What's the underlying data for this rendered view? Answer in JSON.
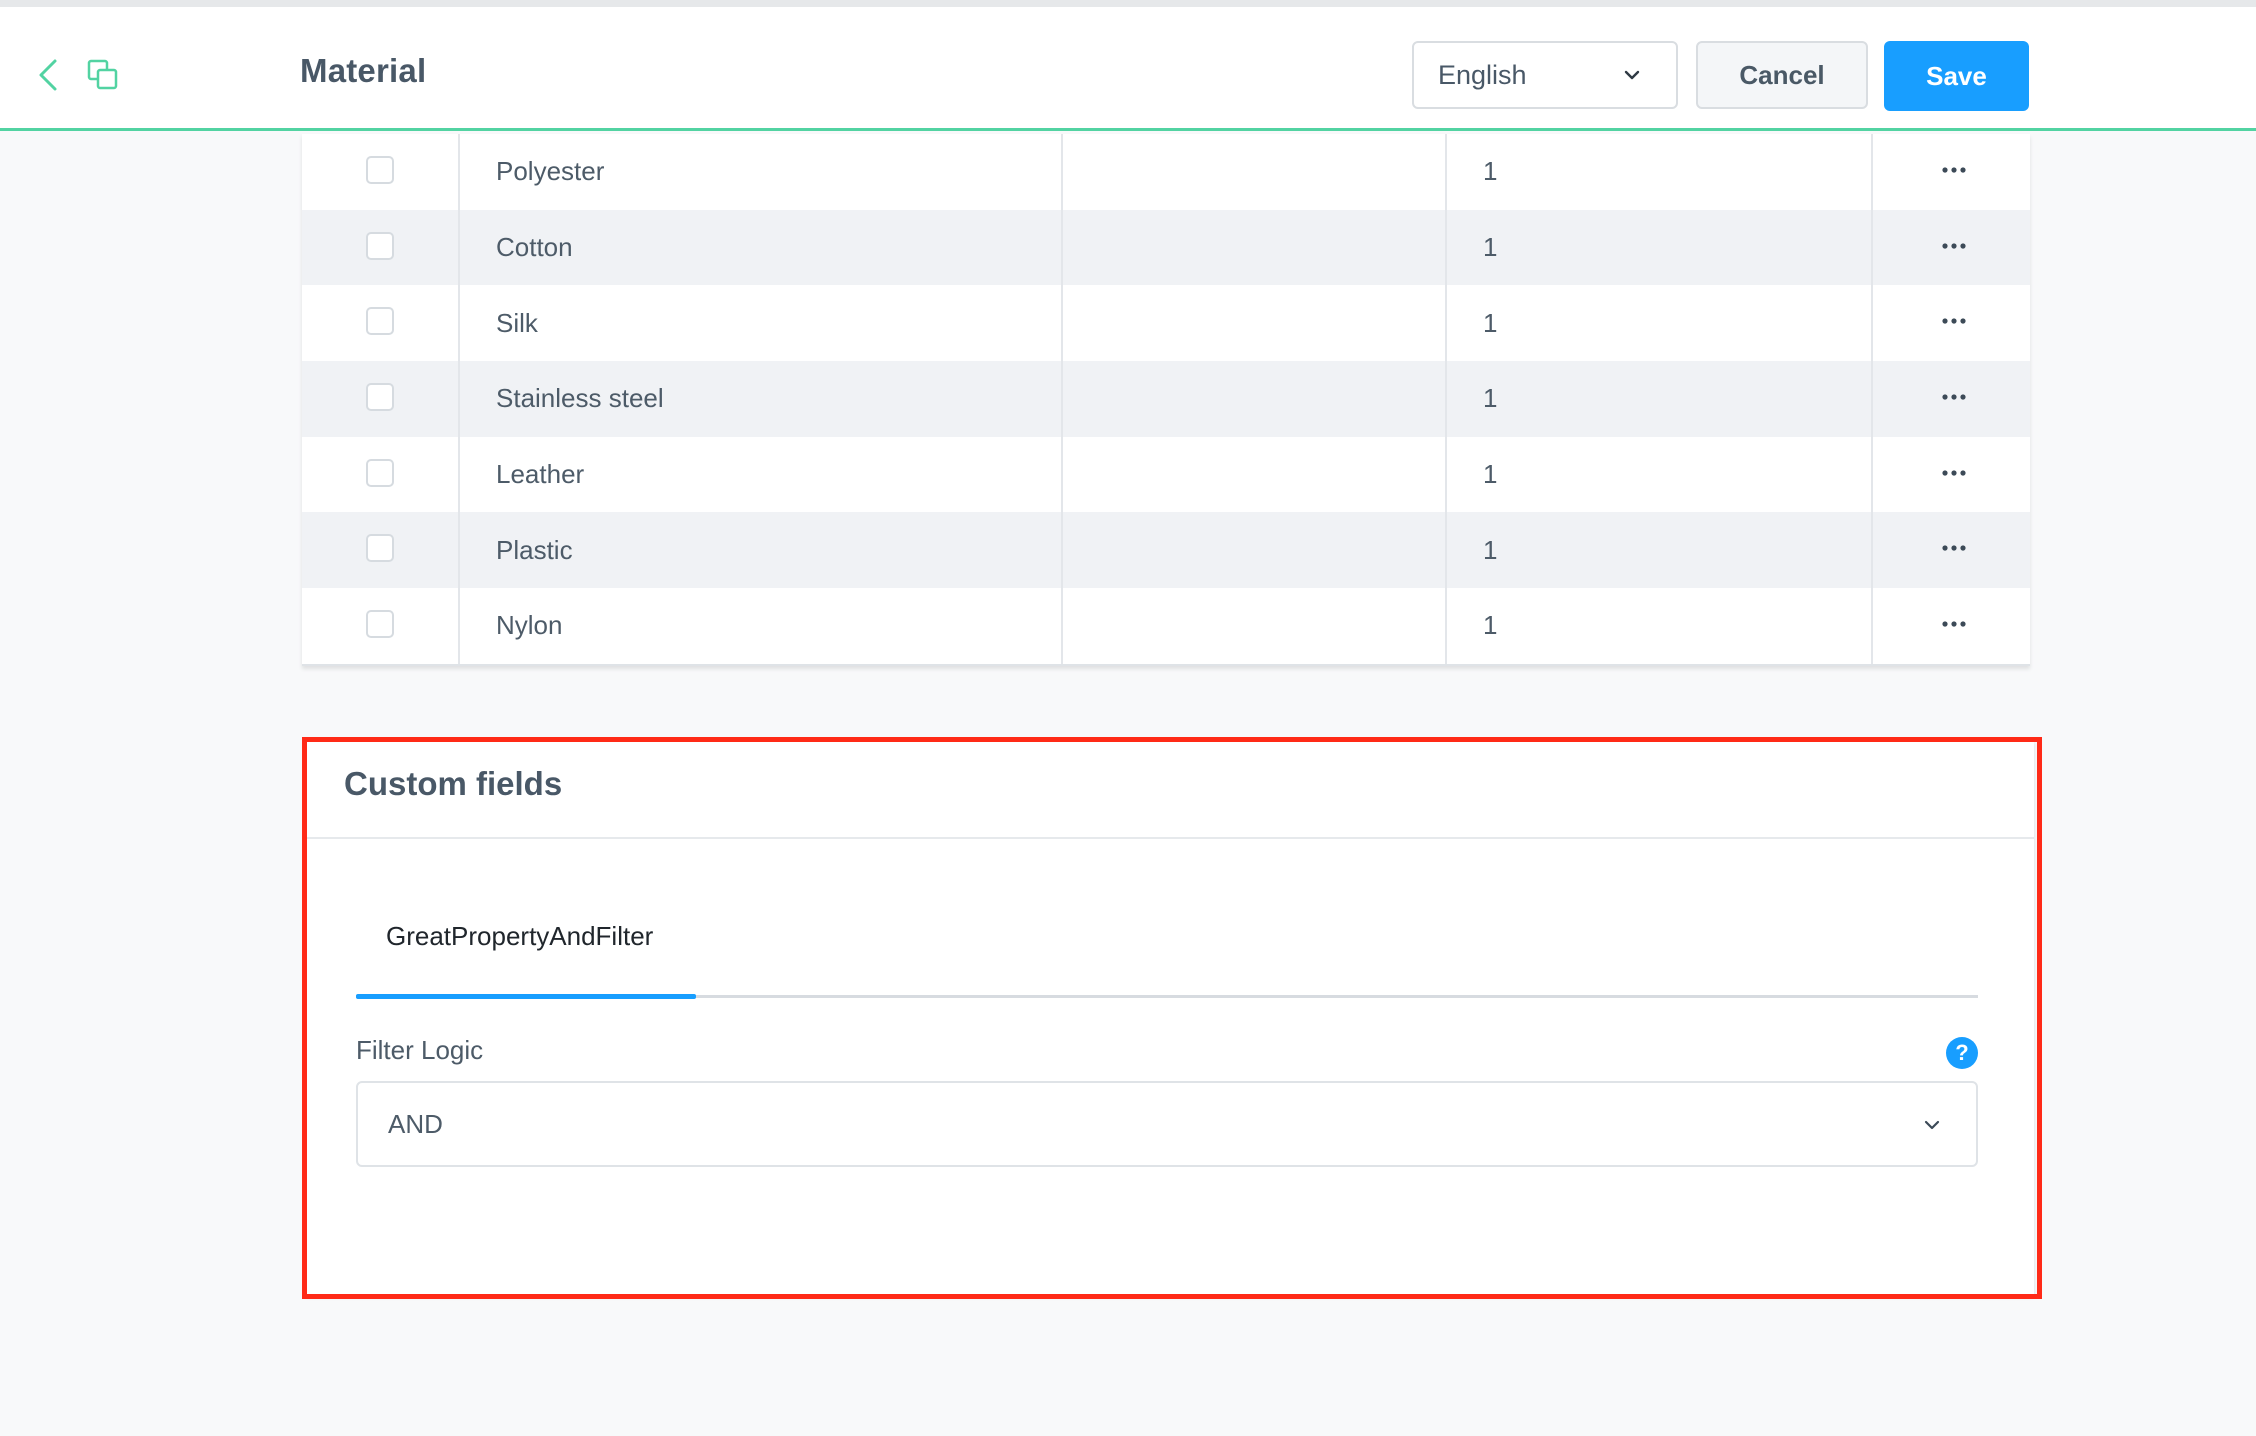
{
  "header": {
    "title": "Material",
    "language": "English",
    "cancel_label": "Cancel",
    "save_label": "Save",
    "accent_color": "#52d3a2",
    "primary_color": "#189eff"
  },
  "table": {
    "rows": [
      {
        "name": "Polyester",
        "value": "1"
      },
      {
        "name": "Cotton",
        "value": "1"
      },
      {
        "name": "Silk",
        "value": "1"
      },
      {
        "name": "Stainless steel",
        "value": "1"
      },
      {
        "name": "Leather",
        "value": "1"
      },
      {
        "name": "Plastic",
        "value": "1"
      },
      {
        "name": "Nylon",
        "value": "1"
      }
    ]
  },
  "custom_fields": {
    "title": "Custom fields",
    "tab_label": "GreatPropertyAndFilter",
    "filter_logic_label": "Filter Logic",
    "filter_logic_value": "AND",
    "help_icon": "question-icon",
    "highlight_color": "#ff2a17"
  }
}
